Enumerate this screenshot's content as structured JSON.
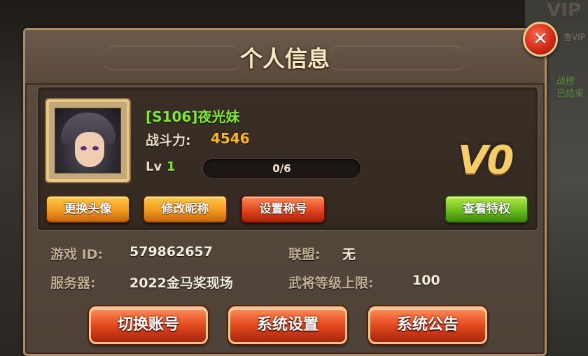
{
  "background": {
    "vip_text": "VIP",
    "vip_sub": "查VIP",
    "rank_line1": "战榜",
    "rank_line2": "已结束"
  },
  "dialog": {
    "title": "个人信息",
    "close_icon": "close-icon"
  },
  "profile": {
    "name": "[S106]夜光妹",
    "power_label": "战斗力:",
    "power_value": "4546",
    "level_label": "Lv",
    "level_value": "1",
    "exp_text": "0/6",
    "exp_progress": 0,
    "vip_level": "V0"
  },
  "profile_buttons": {
    "change_avatar": "更换头像",
    "change_nickname": "修改昵称",
    "set_title": "设置称号",
    "view_privileges": "查看特权"
  },
  "details": {
    "game_id_label": "游戏 ID:",
    "game_id_value": "579862657",
    "server_label": "服务器:",
    "server_value": "2022金马奖现场",
    "alliance_label": "联盟:",
    "alliance_value": "无",
    "general_cap_label": "武将等级上限:",
    "general_cap_value": "100"
  },
  "bottom_buttons": {
    "switch_account": "切换账号",
    "system_settings": "系统设置",
    "system_notice": "系统公告"
  },
  "colors": {
    "name_green": "#7ee832",
    "power_gold": "#ffb81e",
    "vip_gold": "#f4cc6a"
  }
}
